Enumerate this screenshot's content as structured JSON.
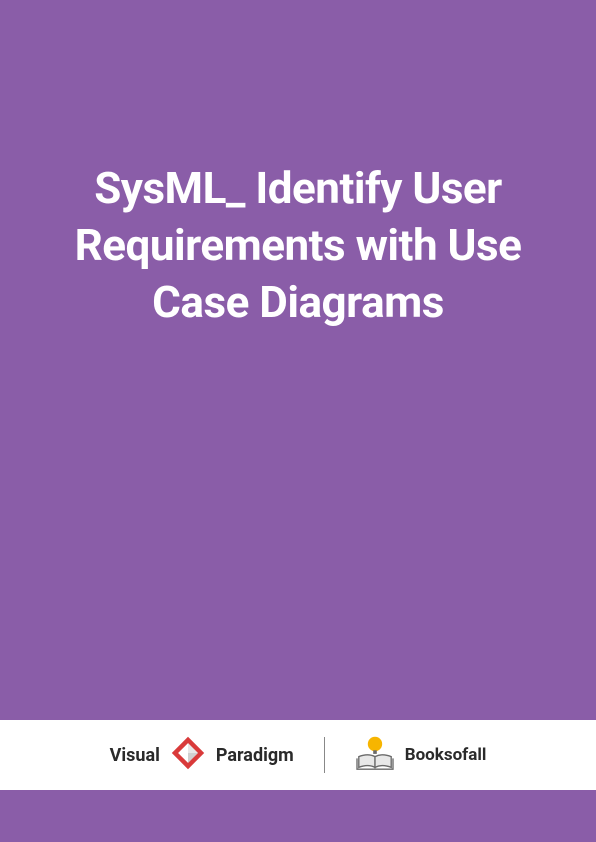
{
  "cover": {
    "title": "SysML_ Identify User Requirements with Use Case Diagrams"
  },
  "footer": {
    "logos": {
      "visualParadigm": {
        "prefix": "Visual",
        "suffix": "Paradigm",
        "iconName": "vp-diamond-icon"
      },
      "booksofall": {
        "label": "Booksofall",
        "iconName": "book-lightbulb-icon"
      }
    }
  },
  "colors": {
    "background": "#8a5da8",
    "footerBand": "#ffffff",
    "titleText": "#ffffff",
    "vpRed": "#d93a3a",
    "bookYellow": "#f7b500",
    "bookGray": "#6a6a6a"
  }
}
